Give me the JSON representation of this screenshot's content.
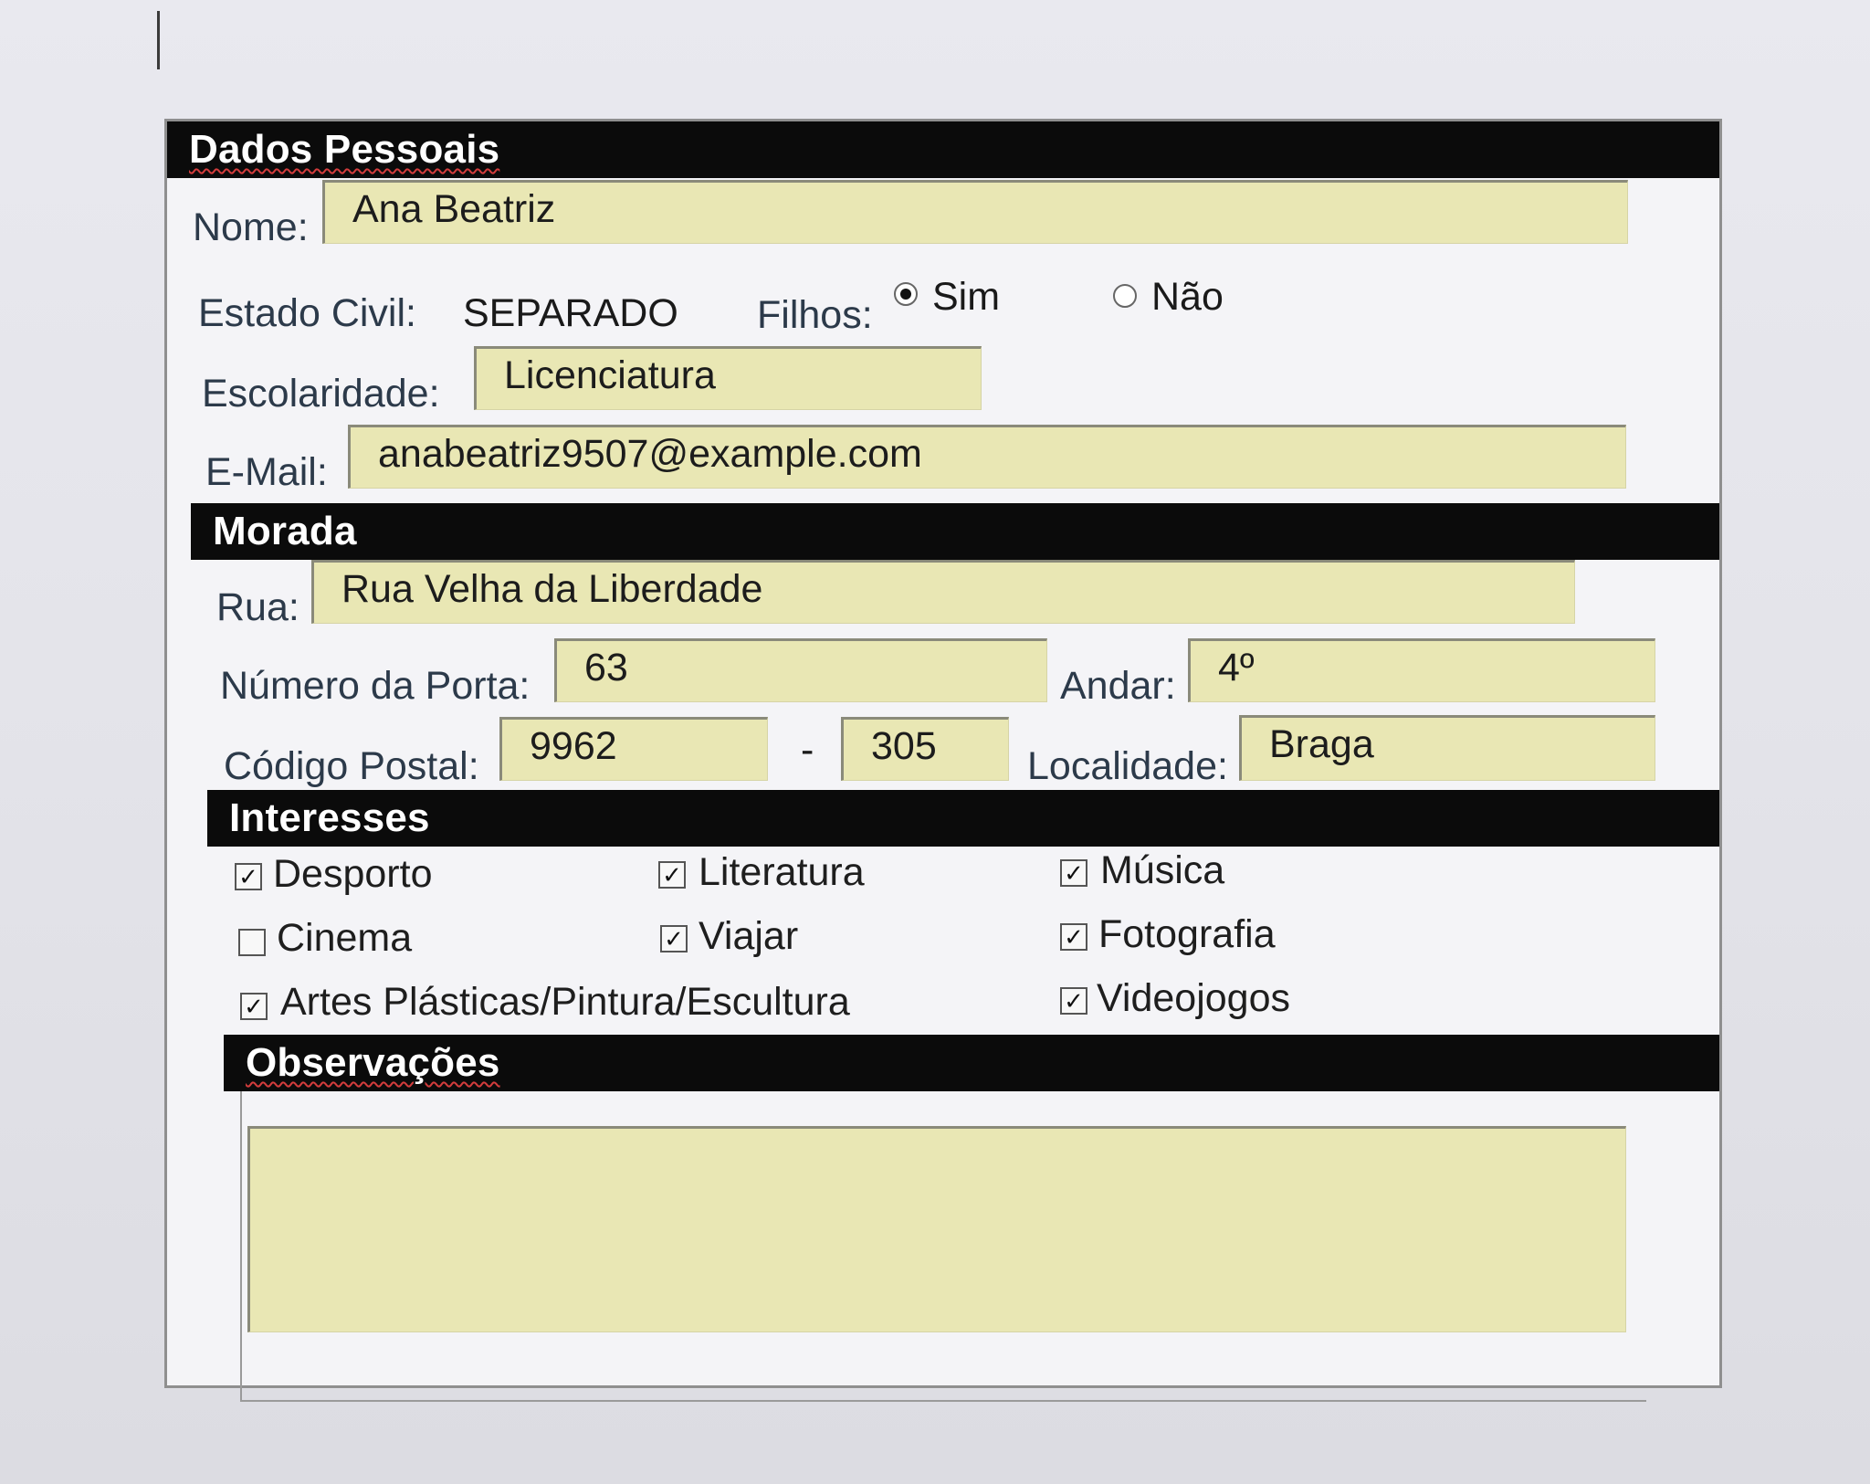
{
  "personal": {
    "header": "Dados Pessoais",
    "nome_label": "Nome:",
    "nome_value": "Ana Beatriz",
    "estado_civil_label": "Estado Civil:",
    "estado_civil_value": "SEPARADO",
    "filhos_label": "Filhos:",
    "filhos_options": [
      {
        "label": "Sim",
        "selected": true
      },
      {
        "label": "Não",
        "selected": false
      }
    ],
    "escolaridade_label": "Escolaridade:",
    "escolaridade_value": "Licenciatura",
    "email_label": "E-Mail:",
    "email_value": "anabeatriz9507@example.com"
  },
  "morada": {
    "header": "Morada",
    "rua_label": "Rua:",
    "rua_value": "Rua Velha da Liberdade",
    "numero_label": "Número da Porta:",
    "numero_value": "63",
    "andar_label": "Andar:",
    "andar_value": "4º",
    "codigo_label": "Código Postal:",
    "codigo_part1": "9962",
    "codigo_sep": "-",
    "codigo_part2": "305",
    "localidade_label": "Localidade:",
    "localidade_value": "Braga"
  },
  "interesses": {
    "header": "Interesses",
    "items": [
      {
        "label": "Desporto",
        "checked": true
      },
      {
        "label": "Literatura",
        "checked": true
      },
      {
        "label": "Música",
        "checked": true
      },
      {
        "label": "Cinema",
        "checked": false
      },
      {
        "label": "Viajar",
        "checked": true
      },
      {
        "label": "Fotografia",
        "checked": true
      },
      {
        "label": "Artes Plásticas/Pintura/Escultura",
        "checked": true
      },
      {
        "label": "Videojogos",
        "checked": true
      }
    ]
  },
  "observacoes": {
    "header": "Observações",
    "value": ""
  },
  "colors": {
    "field_bg": "#e9e7b4",
    "header_bg": "#0b0b0b",
    "header_text": "#ffffff",
    "label_text": "#2c3a4a"
  }
}
